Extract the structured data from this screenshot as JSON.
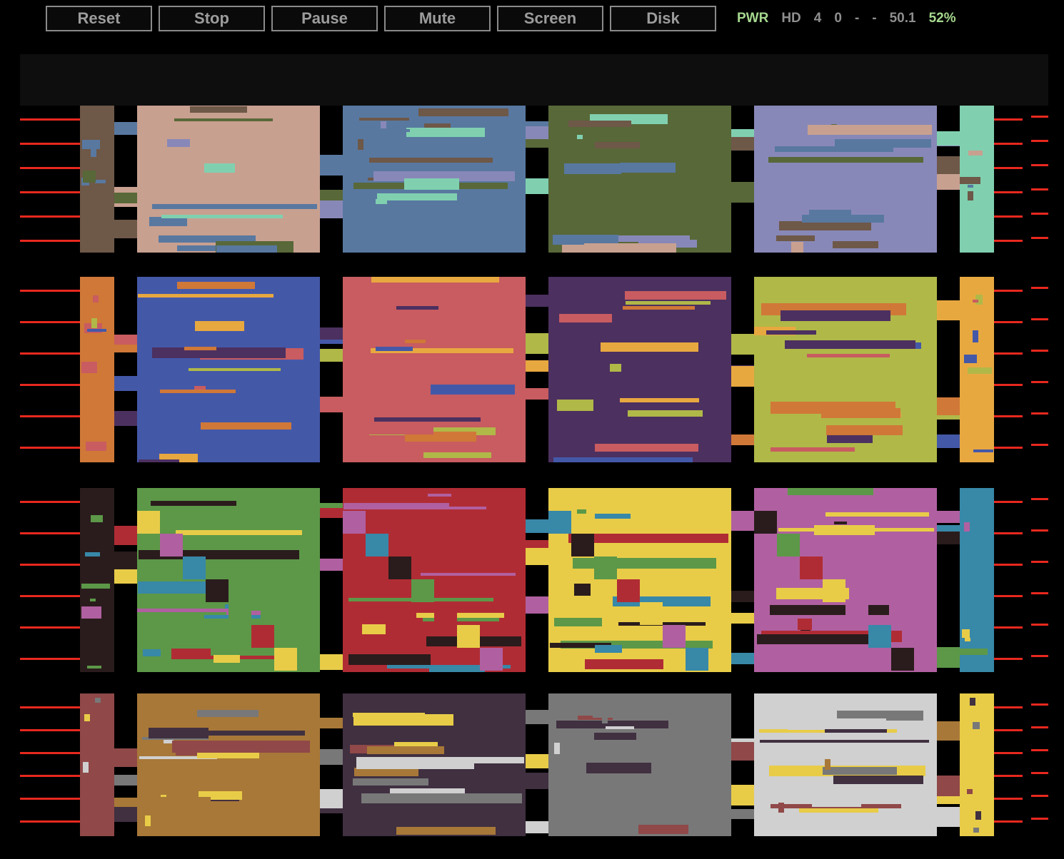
{
  "toolbar": {
    "buttons": [
      {
        "id": "reset",
        "label": "Reset"
      },
      {
        "id": "stop",
        "label": "Stop"
      },
      {
        "id": "pause",
        "label": "Pause"
      },
      {
        "id": "mute",
        "label": "Mute"
      },
      {
        "id": "screen",
        "label": "Screen"
      },
      {
        "id": "disk",
        "label": "Disk"
      }
    ]
  },
  "status": {
    "pwr": "PWR",
    "hd": "HD",
    "v1": "4",
    "v2": "0",
    "v3": "-",
    "v4": "-",
    "fps": "50.1",
    "percent": "52%"
  },
  "colors": {
    "background": "#000000",
    "border_bar": "#0e0e0e",
    "accent_green": "#a6d88e",
    "raster_red": "#e8281e",
    "button_border": "#8a8a8a",
    "button_text": "#9c9c9c"
  },
  "emulator_display": {
    "palette_row_1": [
      "#6e5848",
      "#c8a090",
      "#5878a0",
      "#586838",
      "#8888b8",
      "#80d0b0"
    ],
    "palette_row_2": [
      "#d07838",
      "#4458a8",
      "#c85c60",
      "#4c3060",
      "#b0b848",
      "#e8a840"
    ],
    "palette_row_3": [
      "#2a1c1c",
      "#5c9848",
      "#b02c34",
      "#e8cc48",
      "#b060a0",
      "#3888a8"
    ],
    "palette_row_4": [
      "#904848",
      "#a87838",
      "#403040",
      "#787878",
      "#d0d0d0",
      "#e8cc48"
    ]
  }
}
